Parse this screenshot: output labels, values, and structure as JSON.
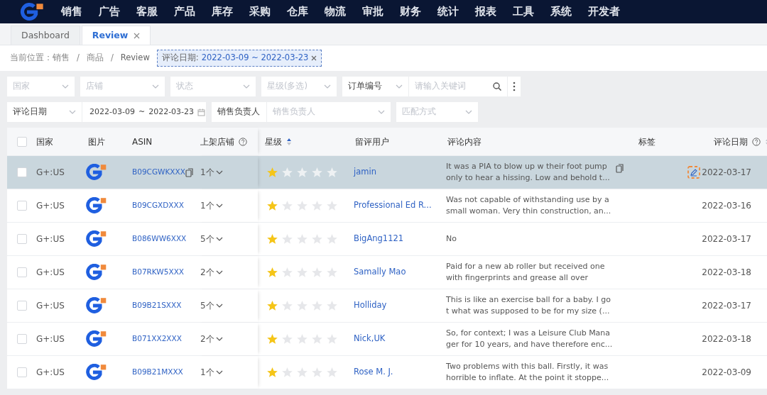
{
  "nav": {
    "items": [
      "销售",
      "广告",
      "客服",
      "产品",
      "库存",
      "采购",
      "仓库",
      "物流",
      "审批",
      "财务",
      "统计",
      "报表",
      "工具",
      "系统",
      "开发者"
    ]
  },
  "tabs": [
    {
      "label": "Dashboard",
      "selected": false,
      "closable": false
    },
    {
      "label": "Review",
      "selected": true,
      "closable": true
    }
  ],
  "breadcrumb": {
    "label": "当前位置：",
    "separator": "/",
    "items": [
      "销售",
      "商品",
      "Review"
    ],
    "filter_tag": {
      "label": "评论日期:",
      "value": "2022-03-09 ~ 2022-03-23"
    }
  },
  "filters": [
    [
      {
        "kind": "select",
        "placeholder": "国家"
      },
      {
        "kind": "select",
        "placeholder": "店铺"
      },
      {
        "kind": "select",
        "placeholder": "状态"
      },
      {
        "kind": "select",
        "placeholder": "星级(多选)"
      },
      {
        "kind": "select",
        "value": "订单编号"
      },
      {
        "kind": "search",
        "placeholder": "请输入关键词"
      },
      {
        "kind": "more"
      }
    ],
    [
      {
        "kind": "select",
        "value": "评论日期"
      },
      {
        "kind": "daterange",
        "from": "2022-03-09",
        "sep": "~",
        "to": "2022-03-23"
      },
      {
        "kind": "label",
        "value": "销售负责人"
      },
      {
        "kind": "select",
        "placeholder": "销售负责人"
      },
      {
        "kind": "select",
        "placeholder": "匹配方式"
      }
    ]
  ],
  "table": {
    "select_all": {
      "checked": false
    },
    "columns": [
      {
        "label": "国家"
      },
      {
        "label": "图片"
      },
      {
        "label": "ASIN"
      },
      {
        "label": "上架店铺",
        "help": true
      },
      {
        "label": "星级",
        "sort_active": true
      },
      {
        "label": "留评用户"
      },
      {
        "label": "评论内容"
      },
      {
        "label": "标签"
      },
      {
        "label": "评论日期",
        "help": true,
        "sort_active": false
      }
    ],
    "rows": [
      {
        "selected": true,
        "checked": false,
        "country": "G+:US",
        "asin": "B09CGWKXXX",
        "stores": "1个",
        "stars": 1,
        "user": "jamin",
        "content": [
          "It was a PIA to blow up w their foot pump",
          "only to hear a hissing. Low and behold t..."
        ],
        "date": "2022-03-17"
      },
      {
        "selected": false,
        "checked": false,
        "country": "G+:US",
        "asin": "B09CGXDXXX",
        "stores": "1个",
        "stars": 1,
        "user": "Professional Ed R...",
        "content": [
          "Was not capable of withstanding use by a",
          "small woman. Very thin construction, an..."
        ],
        "date": "2022-03-16"
      },
      {
        "selected": false,
        "checked": false,
        "country": "G+:US",
        "asin": "B086WW6XXX",
        "stores": "5个",
        "stars": 1,
        "user": "BigAng1121",
        "content": [
          "No"
        ],
        "date": "2022-03-17"
      },
      {
        "selected": false,
        "checked": false,
        "country": "G+:US",
        "asin": "B07RKW5XXX",
        "stores": "2个",
        "stars": 1,
        "user": "Samally Mao",
        "content": [
          "Paid for a new ab roller but received one",
          "with fingerprints and grease all over"
        ],
        "date": "2022-03-18"
      },
      {
        "selected": false,
        "checked": false,
        "country": "G+:US",
        "asin": "B09B21SXXX",
        "stores": "5个",
        "stars": 1,
        "user": "Holliday",
        "content": [
          "This is like an exercise ball for a baby. I go",
          "t what was supposed to be for my size (..."
        ],
        "date": "2022-03-17"
      },
      {
        "selected": false,
        "checked": false,
        "country": "G+:US",
        "asin": "B071XX2XXX",
        "stores": "2个",
        "stars": 1,
        "user": "Nick,UK",
        "content": [
          "So, for context; I was a Leisure Club Mana",
          "ger for 10 years, and have therefore enc..."
        ],
        "date": "2022-03-18"
      },
      {
        "selected": false,
        "checked": false,
        "country": "G+:US",
        "asin": "B09B21MXXX",
        "stores": "1个",
        "stars": 1,
        "user": "Rose M. J.",
        "content": [
          "Two problems with this ball. Firstly, it was",
          "horrible to inflate. At the point it stoppe..."
        ],
        "date": "2022-03-09"
      }
    ]
  }
}
